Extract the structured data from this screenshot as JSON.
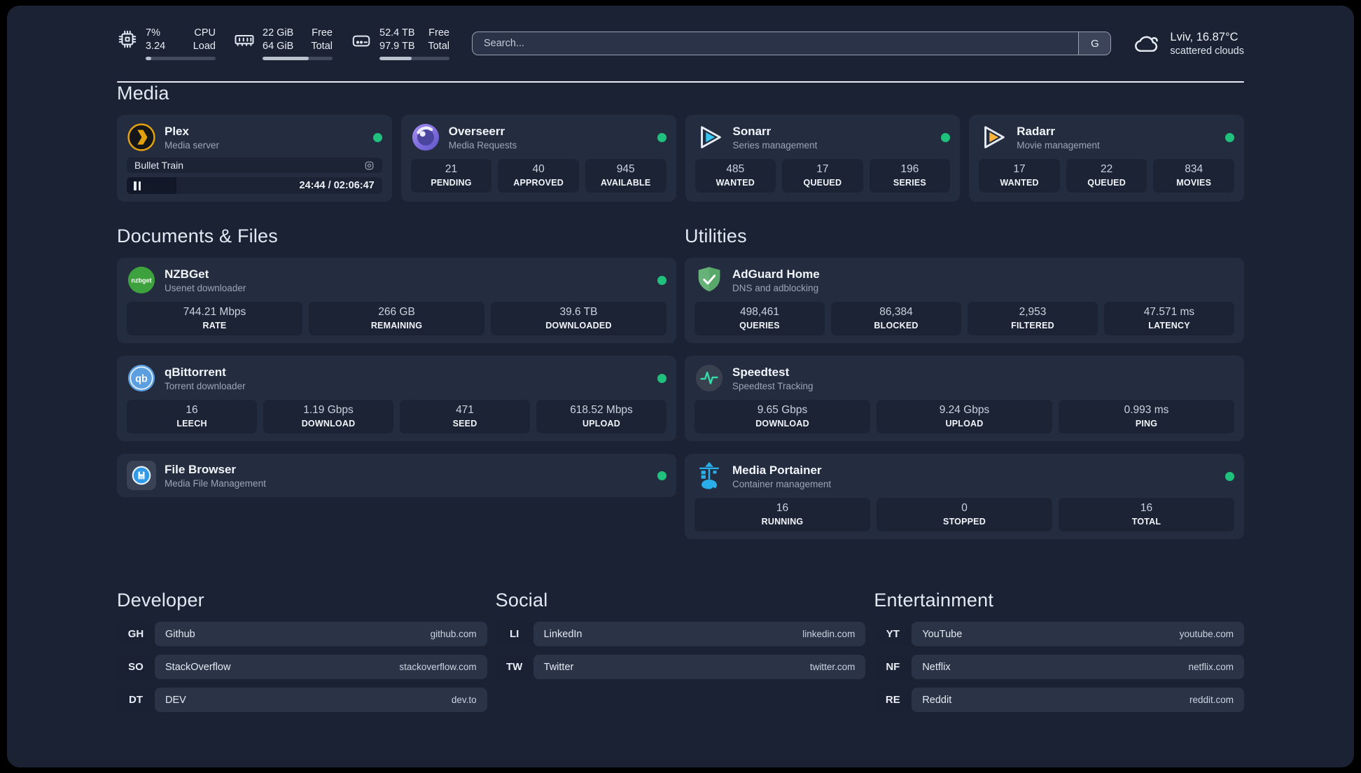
{
  "topbar": {
    "cpu": {
      "icon": "cpu-icon",
      "value_top": "7%",
      "label_top": "CPU",
      "value_bottom": "3.24",
      "label_bottom": "Load",
      "progress_pct": 8
    },
    "memory": {
      "icon": "memory-icon",
      "value_top": "22 GiB",
      "label_top": "Free",
      "value_bottom": "64 GiB",
      "label_bottom": "Total",
      "progress_pct": 66
    },
    "disk": {
      "icon": "disk-icon",
      "value_top": "52.4 TB",
      "label_top": "Free",
      "value_bottom": "97.9 TB",
      "label_bottom": "Total",
      "progress_pct": 46
    },
    "search": {
      "placeholder": "Search...",
      "button_label": "G"
    },
    "weather": {
      "icon": "cloud-icon",
      "title": "Lviv, 16.87°C",
      "subtitle": "scattered clouds"
    }
  },
  "colors": {
    "status_online": "#20C17C",
    "card": "#242D40",
    "background": "#1A2234"
  },
  "sections": {
    "media": {
      "title": "Media",
      "plex": {
        "icon": "plex-icon",
        "name": "Plex",
        "description": "Media server",
        "status": "online",
        "now_playing": {
          "title": "Bullet Train",
          "time_display": "24:44 / 02:06:47",
          "elapsed": "24:44",
          "duration": "02:06:47",
          "progress_pct": 19.5,
          "state": "paused"
        }
      },
      "overseerr": {
        "icon": "overseerr-icon",
        "name": "Overseerr",
        "description": "Media Requests",
        "status": "online",
        "stats": [
          {
            "value": "21",
            "label": "PENDING"
          },
          {
            "value": "40",
            "label": "APPROVED"
          },
          {
            "value": "945",
            "label": "AVAILABLE"
          }
        ]
      },
      "sonarr": {
        "icon": "sonarr-icon",
        "name": "Sonarr",
        "description": "Series management",
        "status": "online",
        "stats": [
          {
            "value": "485",
            "label": "WANTED"
          },
          {
            "value": "17",
            "label": "QUEUED"
          },
          {
            "value": "196",
            "label": "SERIES"
          }
        ]
      },
      "radarr": {
        "icon": "radarr-icon",
        "name": "Radarr",
        "description": "Movie management",
        "status": "online",
        "stats": [
          {
            "value": "17",
            "label": "WANTED"
          },
          {
            "value": "22",
            "label": "QUEUED"
          },
          {
            "value": "834",
            "label": "MOVIES"
          }
        ]
      }
    },
    "documents": {
      "title": "Documents & Files",
      "nzbget": {
        "icon": "nzbget-icon",
        "name": "NZBGet",
        "description": "Usenet downloader",
        "status": "online",
        "stats": [
          {
            "value": "744.21 Mbps",
            "label": "RATE"
          },
          {
            "value": "266 GB",
            "label": "REMAINING"
          },
          {
            "value": "39.6 TB",
            "label": "DOWNLOADED"
          }
        ]
      },
      "qbittorrent": {
        "icon": "qbittorrent-icon",
        "name": "qBittorrent",
        "description": "Torrent downloader",
        "status": "online",
        "stats": [
          {
            "value": "16",
            "label": "LEECH"
          },
          {
            "value": "1.19 Gbps",
            "label": "DOWNLOAD"
          },
          {
            "value": "471",
            "label": "SEED"
          },
          {
            "value": "618.52 Mbps",
            "label": "UPLOAD"
          }
        ]
      },
      "filebrowser": {
        "icon": "filebrowser-icon",
        "name": "File Browser",
        "description": "Media File Management",
        "status": "online"
      }
    },
    "utilities": {
      "title": "Utilities",
      "adguard": {
        "icon": "adguard-icon",
        "name": "AdGuard Home",
        "description": "DNS and adblocking",
        "stats": [
          {
            "value": "498,461",
            "label": "QUERIES"
          },
          {
            "value": "86,384",
            "label": "BLOCKED"
          },
          {
            "value": "2,953",
            "label": "FILTERED"
          },
          {
            "value": "47.571 ms",
            "label": "LATENCY"
          }
        ]
      },
      "speedtest": {
        "icon": "speedtest-icon",
        "name": "Speedtest",
        "description": "Speedtest Tracking",
        "stats": [
          {
            "value": "9.65 Gbps",
            "label": "DOWNLOAD"
          },
          {
            "value": "9.24 Gbps",
            "label": "UPLOAD"
          },
          {
            "value": "0.993 ms",
            "label": "PING"
          }
        ]
      },
      "portainer": {
        "icon": "portainer-icon",
        "name": "Media Portainer",
        "description": "Container management",
        "status": "online",
        "stats": [
          {
            "value": "16",
            "label": "RUNNING"
          },
          {
            "value": "0",
            "label": "STOPPED"
          },
          {
            "value": "16",
            "label": "TOTAL"
          }
        ]
      }
    },
    "developer": {
      "title": "Developer",
      "links": [
        {
          "tag": "GH",
          "name": "Github",
          "url": "github.com"
        },
        {
          "tag": "SO",
          "name": "StackOverflow",
          "url": "stackoverflow.com"
        },
        {
          "tag": "DT",
          "name": "DEV",
          "url": "dev.to"
        }
      ]
    },
    "social": {
      "title": "Social",
      "links": [
        {
          "tag": "LI",
          "name": "LinkedIn",
          "url": "linkedin.com"
        },
        {
          "tag": "TW",
          "name": "Twitter",
          "url": "twitter.com"
        }
      ]
    },
    "entertainment": {
      "title": "Entertainment",
      "links": [
        {
          "tag": "YT",
          "name": "YouTube",
          "url": "youtube.com"
        },
        {
          "tag": "NF",
          "name": "Netflix",
          "url": "netflix.com"
        },
        {
          "tag": "RE",
          "name": "Reddit",
          "url": "reddit.com"
        }
      ]
    }
  }
}
